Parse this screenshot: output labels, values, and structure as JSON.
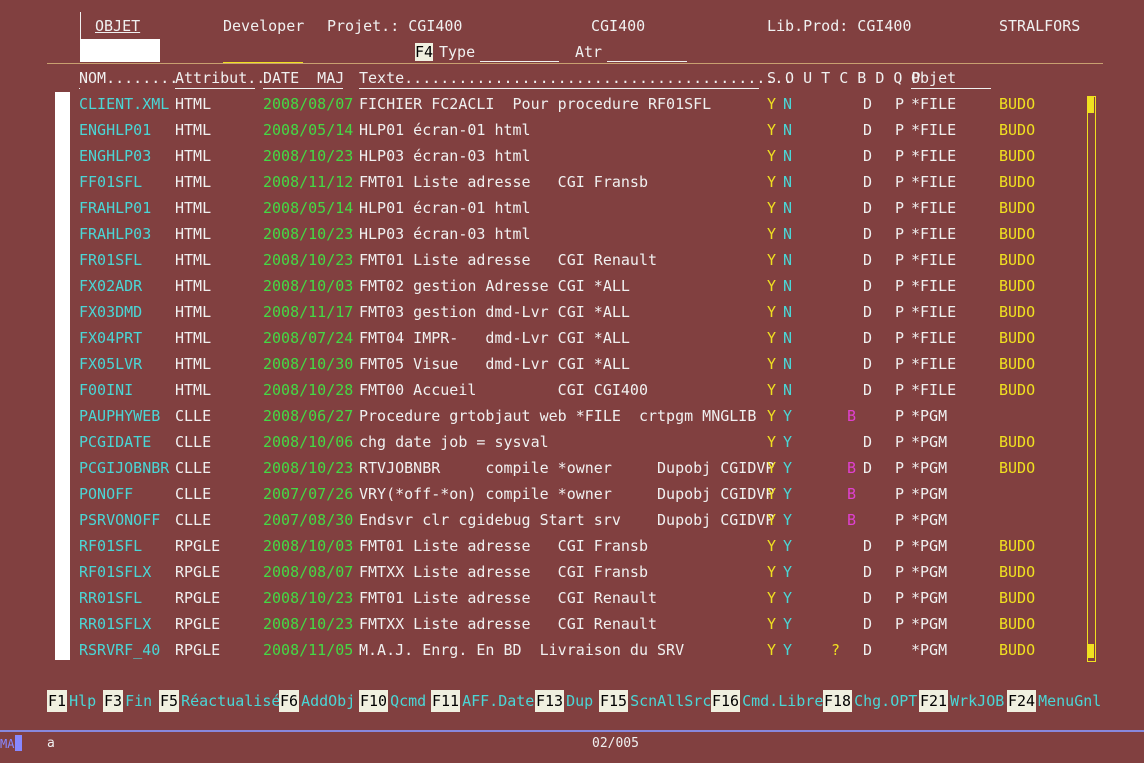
{
  "header": {
    "objet_label": "OBJET",
    "developer": "Developer",
    "projet": "Projet.: CGI400",
    "projet_center": "CGI400",
    "lib_prod": "Lib.Prod: CGI400",
    "company": "STRALFORS",
    "f4_key": "F4",
    "type_label": "Type",
    "atr_label": "Atr",
    "objet_input_value": ""
  },
  "columns": {
    "nom": "NOM........",
    "attribut": "Attribut..",
    "date": "DATE  MAJ",
    "texte": "Texte...........................................",
    "flags": "S O U T C B D Q P",
    "objet": "Objet"
  },
  "rows": [
    {
      "nom": "CLIENT.XML",
      "attr": "HTML",
      "date": "2008/08/07",
      "texte": "FICHIER FC2ACLI  Pour procedure RF01SFL",
      "s": "Y",
      "o": "N",
      "b": "",
      "d": "D",
      "p": "P",
      "type": "*FILE",
      "lib": "BUDO"
    },
    {
      "nom": "ENGHLP01",
      "attr": "HTML",
      "date": "2008/05/14",
      "texte": "HLP01 écran-01 html",
      "s": "Y",
      "o": "N",
      "b": "",
      "d": "D",
      "p": "P",
      "type": "*FILE",
      "lib": "BUDO"
    },
    {
      "nom": "ENGHLP03",
      "attr": "HTML",
      "date": "2008/10/23",
      "texte": "HLP03 écran-03 html",
      "s": "Y",
      "o": "N",
      "b": "",
      "d": "D",
      "p": "P",
      "type": "*FILE",
      "lib": "BUDO"
    },
    {
      "nom": "FF01SFL",
      "attr": "HTML",
      "date": "2008/11/12",
      "texte": "FMT01 Liste adresse   CGI Fransb",
      "s": "Y",
      "o": "N",
      "b": "",
      "d": "D",
      "p": "P",
      "type": "*FILE",
      "lib": "BUDO"
    },
    {
      "nom": "FRAHLP01",
      "attr": "HTML",
      "date": "2008/05/14",
      "texte": "HLP01 écran-01 html",
      "s": "Y",
      "o": "N",
      "b": "",
      "d": "D",
      "p": "P",
      "type": "*FILE",
      "lib": "BUDO"
    },
    {
      "nom": "FRAHLP03",
      "attr": "HTML",
      "date": "2008/10/23",
      "texte": "HLP03 écran-03 html",
      "s": "Y",
      "o": "N",
      "b": "",
      "d": "D",
      "p": "P",
      "type": "*FILE",
      "lib": "BUDO"
    },
    {
      "nom": "FR01SFL",
      "attr": "HTML",
      "date": "2008/10/23",
      "texte": "FMT01 Liste adresse   CGI Renault",
      "s": "Y",
      "o": "N",
      "b": "",
      "d": "D",
      "p": "P",
      "type": "*FILE",
      "lib": "BUDO"
    },
    {
      "nom": "FX02ADR",
      "attr": "HTML",
      "date": "2008/10/03",
      "texte": "FMT02 gestion Adresse CGI *ALL",
      "s": "Y",
      "o": "N",
      "b": "",
      "d": "D",
      "p": "P",
      "type": "*FILE",
      "lib": "BUDO"
    },
    {
      "nom": "FX03DMD",
      "attr": "HTML",
      "date": "2008/11/17",
      "texte": "FMT03 gestion dmd-Lvr CGI *ALL",
      "s": "Y",
      "o": "N",
      "b": "",
      "d": "D",
      "p": "P",
      "type": "*FILE",
      "lib": "BUDO"
    },
    {
      "nom": "FX04PRT",
      "attr": "HTML",
      "date": "2008/07/24",
      "texte": "FMT04 IMPR-   dmd-Lvr CGI *ALL",
      "s": "Y",
      "o": "N",
      "b": "",
      "d": "D",
      "p": "P",
      "type": "*FILE",
      "lib": "BUDO"
    },
    {
      "nom": "FX05LVR",
      "attr": "HTML",
      "date": "2008/10/30",
      "texte": "FMT05 Visue   dmd-Lvr CGI *ALL",
      "s": "Y",
      "o": "N",
      "b": "",
      "d": "D",
      "p": "P",
      "type": "*FILE",
      "lib": "BUDO"
    },
    {
      "nom": "F00INI",
      "attr": "HTML",
      "date": "2008/10/28",
      "texte": "FMT00 Accueil         CGI CGI400",
      "s": "Y",
      "o": "N",
      "b": "",
      "d": "D",
      "p": "P",
      "type": "*FILE",
      "lib": "BUDO"
    },
    {
      "nom": "PAUPHYWEB",
      "attr": "CLLE",
      "date": "2008/06/27",
      "texte": "Procedure grtobjaut web *FILE  crtpgm MNGLIB",
      "s": "Y",
      "o": "Y",
      "b": "B",
      "d": "",
      "p": "P",
      "type": "*PGM",
      "lib": ""
    },
    {
      "nom": "PCGIDATE",
      "attr": "CLLE",
      "date": "2008/10/06",
      "texte": "chg date job = sysval",
      "s": "Y",
      "o": "Y",
      "b": "",
      "d": "D",
      "p": "P",
      "type": "*PGM",
      "lib": "BUDO"
    },
    {
      "nom": "PCGIJOBNBR",
      "attr": "CLLE",
      "date": "2008/10/23",
      "texte": "RTVJOBNBR     compile *owner     Dupobj CGIDVP",
      "s": "Y",
      "o": "Y",
      "b": "B",
      "d": "D",
      "p": "P",
      "type": "*PGM",
      "lib": "BUDO"
    },
    {
      "nom": "PONOFF",
      "attr": "CLLE",
      "date": "2007/07/26",
      "texte": "VRY(*off-*on) compile *owner     Dupobj CGIDVP",
      "s": "Y",
      "o": "Y",
      "b": "B",
      "d": "",
      "p": "P",
      "type": "*PGM",
      "lib": ""
    },
    {
      "nom": "PSRVONOFF",
      "attr": "CLLE",
      "date": "2007/08/30",
      "texte": "Endsvr clr cgidebug Start srv    Dupobj CGIDVP",
      "s": "Y",
      "o": "Y",
      "b": "B",
      "d": "",
      "p": "P",
      "type": "*PGM",
      "lib": ""
    },
    {
      "nom": "RF01SFL",
      "attr": "RPGLE",
      "date": "2008/10/03",
      "texte": "FMT01 Liste adresse   CGI Fransb",
      "s": "Y",
      "o": "Y",
      "b": "",
      "d": "D",
      "p": "P",
      "type": "*PGM",
      "lib": "BUDO"
    },
    {
      "nom": "RF01SFLX",
      "attr": "RPGLE",
      "date": "2008/08/07",
      "texte": "FMTXX Liste adresse   CGI Fransb",
      "s": "Y",
      "o": "Y",
      "b": "",
      "d": "D",
      "p": "P",
      "type": "*PGM",
      "lib": "BUDO"
    },
    {
      "nom": "RR01SFL",
      "attr": "RPGLE",
      "date": "2008/10/23",
      "texte": "FMT01 Liste adresse   CGI Renault",
      "s": "Y",
      "o": "Y",
      "b": "",
      "d": "D",
      "p": "P",
      "type": "*PGM",
      "lib": "BUDO"
    },
    {
      "nom": "RR01SFLX",
      "attr": "RPGLE",
      "date": "2008/10/23",
      "texte": "FMTXX Liste adresse   CGI Renault",
      "s": "Y",
      "o": "Y",
      "b": "",
      "d": "D",
      "p": "P",
      "type": "*PGM",
      "lib": "BUDO"
    },
    {
      "nom": "RSRVRF_40",
      "attr": "RPGLE",
      "date": "2008/11/05",
      "texte": "M.A.J. Enrg. En BD  Livraison du SRV",
      "s": "Y",
      "o": "Y",
      "b": "?",
      "d": "D",
      "p": "",
      "type": "*PGM",
      "lib": "BUDO"
    }
  ],
  "fkeys": [
    {
      "key": "F1",
      "label": "Hlp"
    },
    {
      "key": "F3",
      "label": "Fin"
    },
    {
      "key": "F5",
      "label": "Réactualisé"
    },
    {
      "key": "F6",
      "label": "AddObj"
    },
    {
      "key": "F10",
      "label": "Qcmd"
    },
    {
      "key": "F11",
      "label": "AFF.Date"
    },
    {
      "key": "F13",
      "label": "Dup"
    },
    {
      "key": "F15",
      "label": "ScnAllSrc"
    },
    {
      "key": "F16",
      "label": "Cmd.Libre"
    },
    {
      "key": "F18",
      "label": "Chg.OPT"
    },
    {
      "key": "F21",
      "label": "WrkJOB"
    },
    {
      "key": "F24",
      "label": "MenuGnl"
    }
  ],
  "status": {
    "left": "MA",
    "mode": "a",
    "position": "02/005"
  },
  "colors": {
    "background": "#814040",
    "name": "#4ad6d6",
    "date": "#44d944",
    "lib": "#f0e020",
    "flag_b": "#e040d0"
  }
}
